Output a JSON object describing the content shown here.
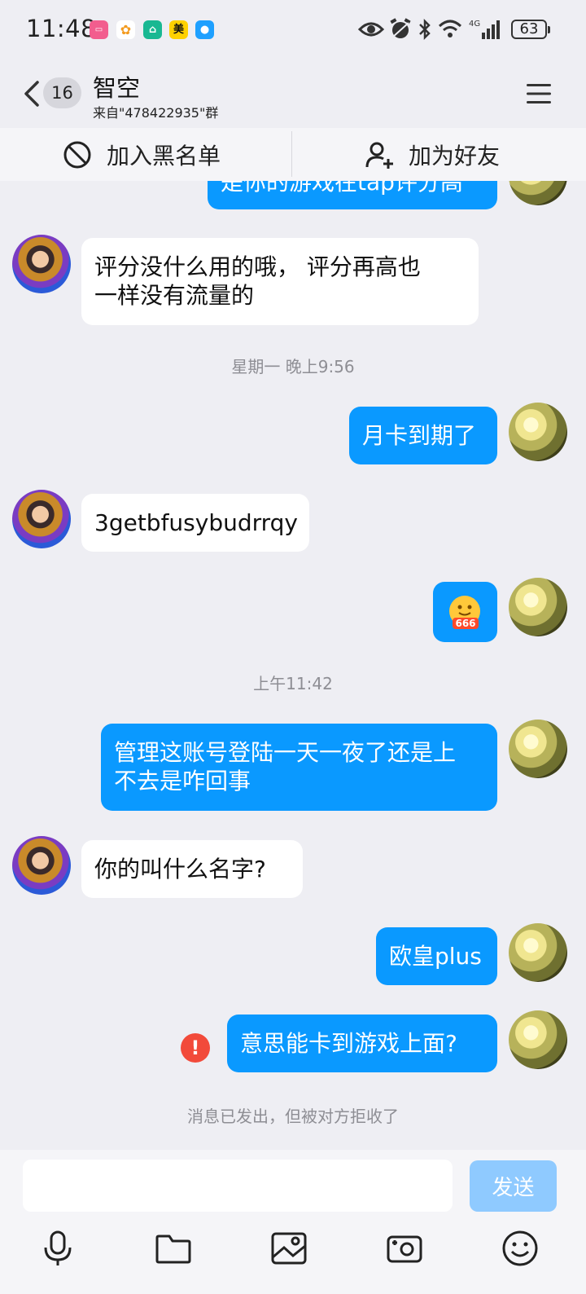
{
  "status_bar": {
    "time": "11:48",
    "battery": "63",
    "app_icons": [
      "bilibili-icon",
      "app-icon",
      "mi-home-icon",
      "meituan-icon",
      "message-icon"
    ],
    "meituan_label": "美"
  },
  "header": {
    "unread_count": "16",
    "title": "智空",
    "subtitle": "来自\"478422935\"群"
  },
  "action_bar": {
    "blacklist_label": "加入黑名单",
    "add_friend_label": "加为好友"
  },
  "messages": [
    {
      "side": "out",
      "text": "是你的游戏在tap评分高",
      "partial": true
    },
    {
      "side": "in",
      "text": "评分没什么用的哦， 评分再高也一样没有流量的"
    },
    {
      "type": "time",
      "text": "星期一 晚上9:56"
    },
    {
      "side": "out",
      "text": "月卡到期了"
    },
    {
      "side": "in",
      "text": "3getbfusybudrrqy"
    },
    {
      "side": "out",
      "sticker": "666-sticker",
      "sticker_text": "666"
    },
    {
      "type": "time",
      "text": "上午11:42"
    },
    {
      "side": "out",
      "text": "管理这账号登陆一天一夜了还是上不去是咋回事"
    },
    {
      "side": "in",
      "text": "你的叫什么名字?"
    },
    {
      "side": "out",
      "text": "欧皇plus"
    },
    {
      "side": "out",
      "text": "意思能卡到游戏上面?",
      "status": "failed"
    }
  ],
  "msg": {
    "m0_text": "是你的游戏在tap评分高",
    "m1_line1": "评分没什么用的哦， 评分再高也",
    "m1_line2": "一样没有流量的",
    "t1": "星期一 晚上9:56",
    "m2": "月卡到期了",
    "m3": "3getbfusybudrrqy",
    "sticker_text": "666",
    "t2": "上午11:42",
    "m5_line1": "管理这账号登陆一天一夜了还是上",
    "m5_line2": "不去是咋回事",
    "m6": "你的叫什么名字?",
    "m7": "欧皇plus",
    "m8": "意思能卡到游戏上面?",
    "error_mark": "!",
    "rejected_notice": "消息已发出，但被对方拒收了"
  },
  "input": {
    "placeholder": "",
    "send_label": "发送"
  },
  "toolbar": [
    "microphone-icon",
    "folder-icon",
    "image-icon",
    "camera-icon",
    "emoji-icon"
  ],
  "colors": {
    "background": "#eeeef3",
    "outgoing_bubble": "#0a99ff",
    "incoming_bubble": "#ffffff",
    "send_button_disabled": "#8fcaff",
    "error": "#f24a3a"
  }
}
